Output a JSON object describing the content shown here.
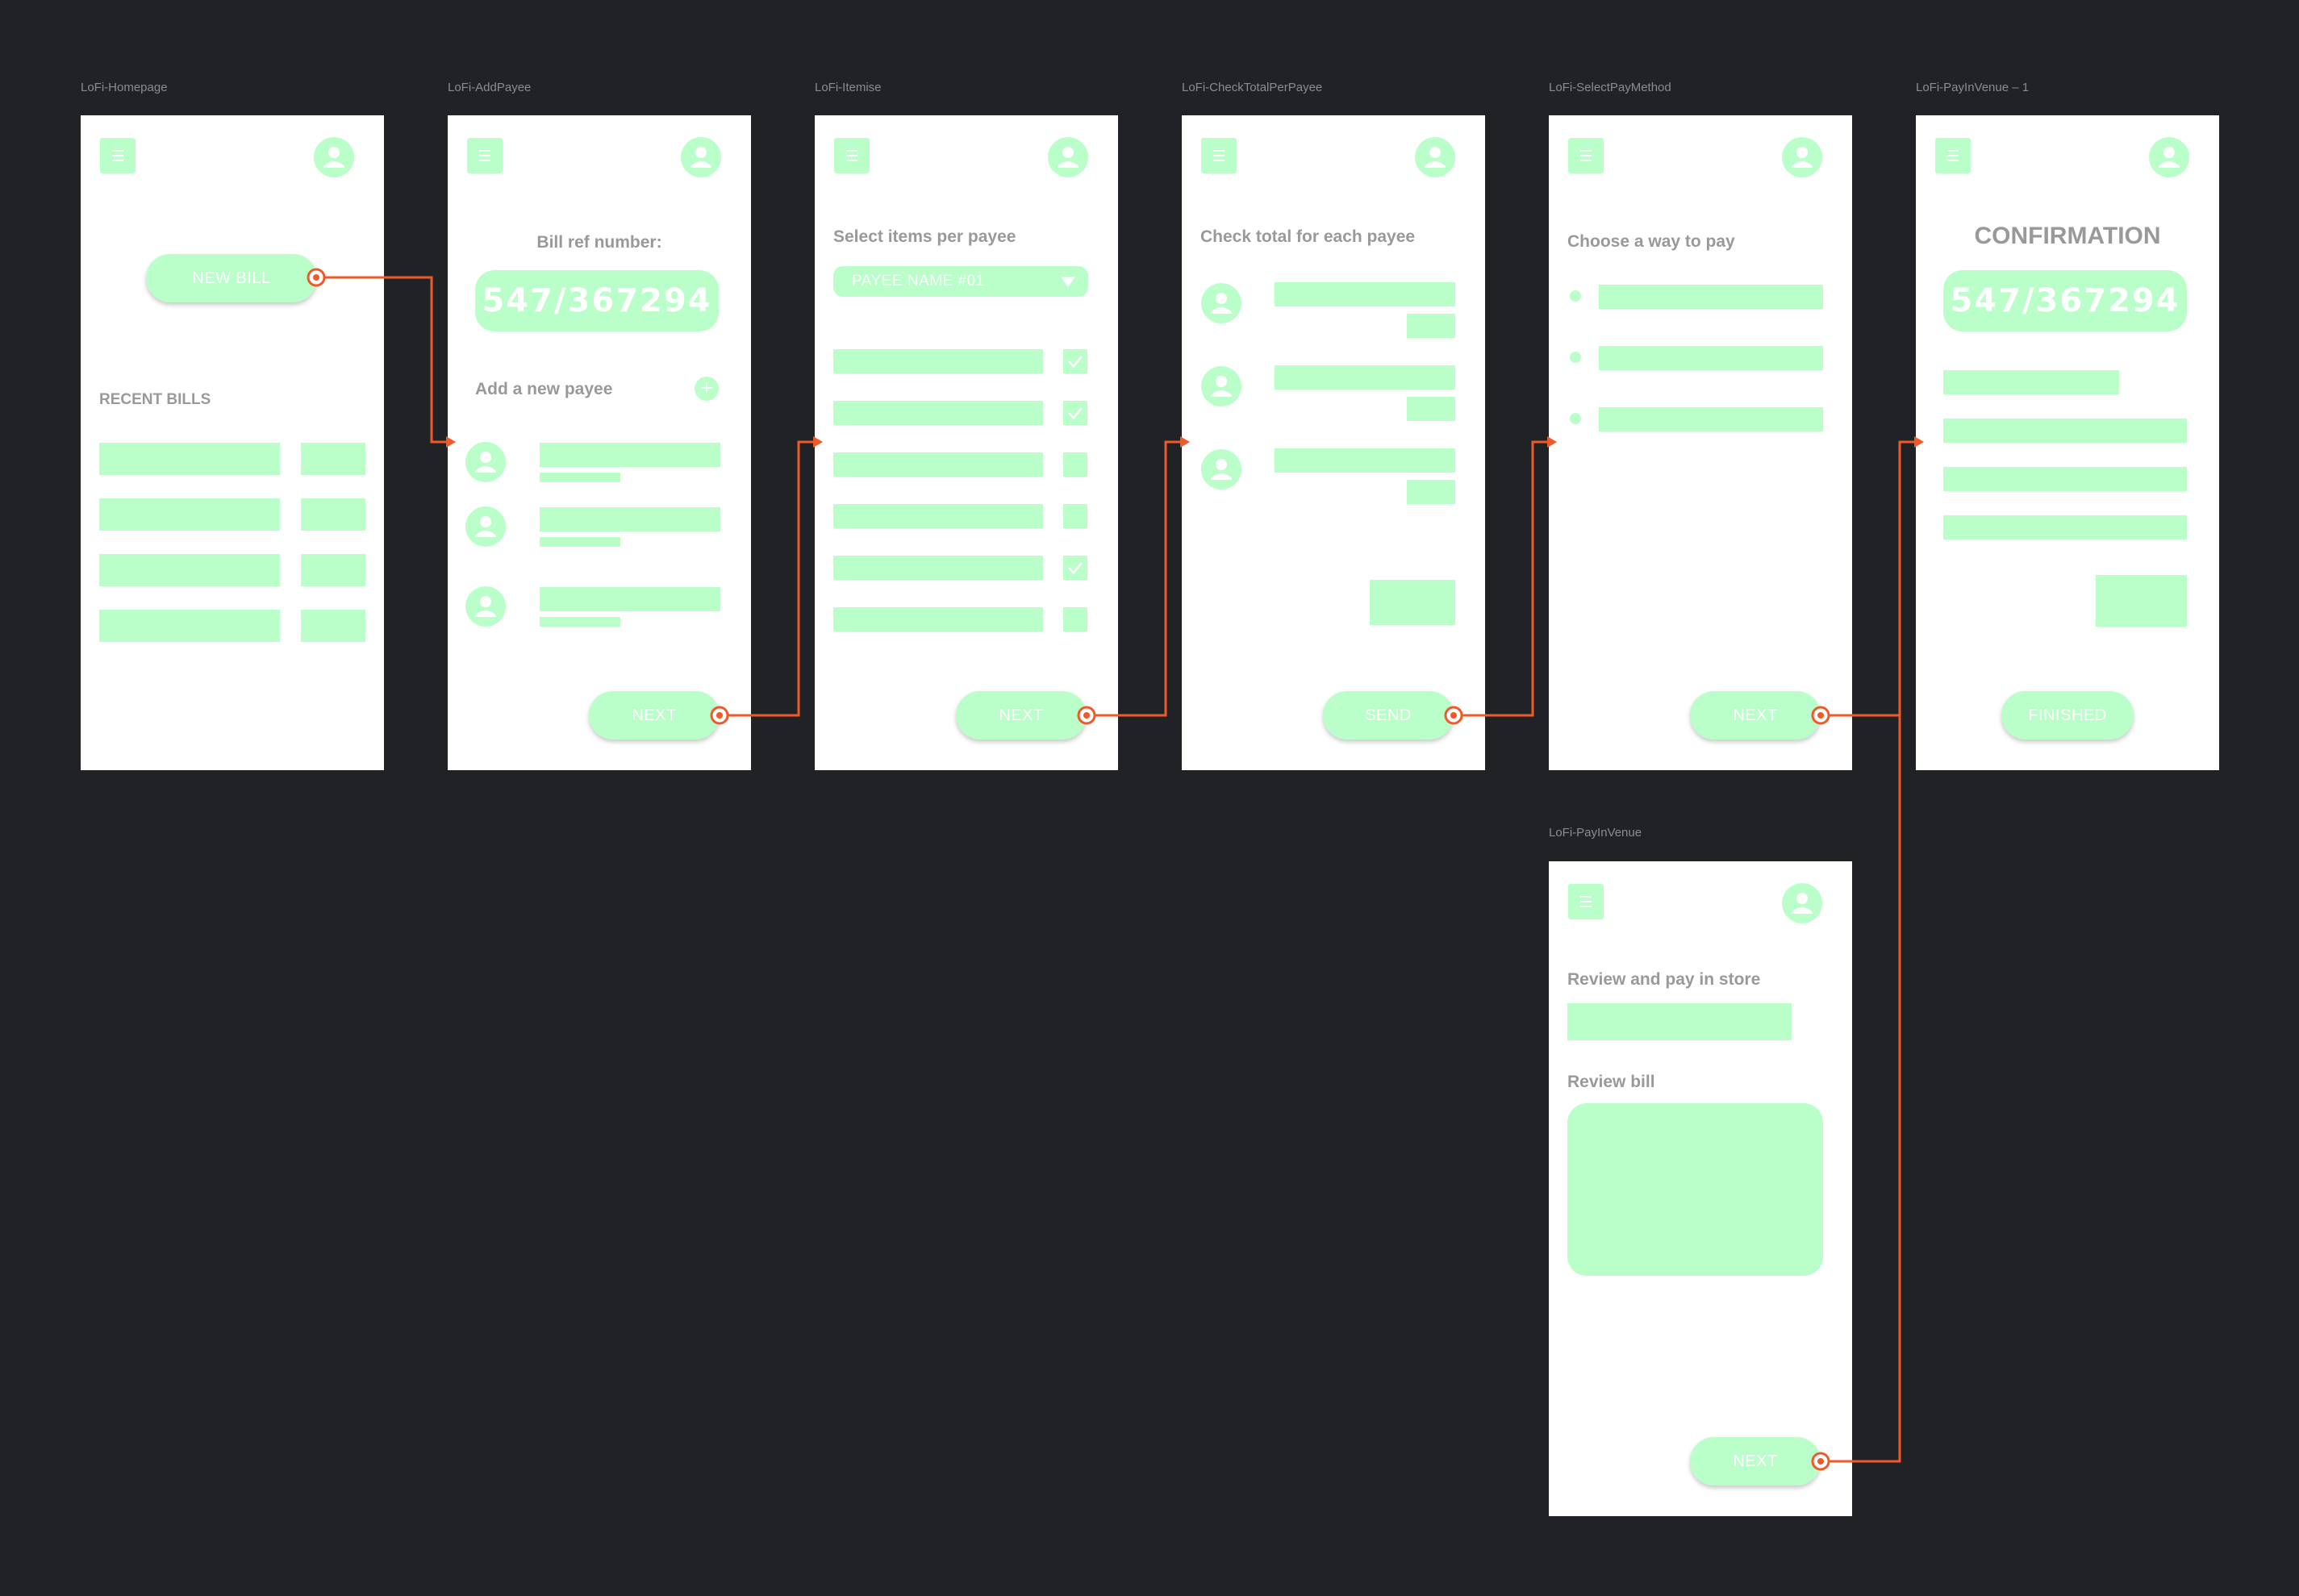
{
  "labels": {
    "homepage": "LoFi-Homepage",
    "add_payee": "LoFi-AddPayee",
    "itemise": "LoFi-Itemise",
    "check_total": "LoFi-CheckTotalPerPayee",
    "select_pay": "LoFi-SelectPayMethod",
    "pay_in_venue_1": "LoFi-PayInVenue – 1",
    "pay_in_venue": "LoFi-PayInVenue"
  },
  "homepage": {
    "new_bill": "NEW BILL",
    "recent_bills": "RECENT BILLS"
  },
  "add_payee": {
    "bill_ref_label": "Bill ref number:",
    "bill_ref": "547/367294",
    "add_payee": "Add a new payee",
    "plus": "+",
    "next": "NEXT"
  },
  "itemise": {
    "title": "Select items per payee",
    "payee_select": "PAYEE NAME #01",
    "checked": [
      true,
      true,
      false,
      false,
      true,
      false
    ],
    "next": "NEXT"
  },
  "check_total": {
    "title": "Check total for each payee",
    "send": "SEND"
  },
  "select_pay": {
    "title": "Choose a way to pay",
    "next": "NEXT"
  },
  "confirmation": {
    "title": "CONFIRMATION",
    "bill_ref": "547/367294",
    "finished": "FINISHED"
  },
  "pay_in_venue": {
    "review_pay": "Review and pay in store",
    "review_bill": "Review bill",
    "next": "NEXT"
  },
  "colors": {
    "canvas": "#212226",
    "artboard": "#ffffff",
    "wireframe_fill": "#baffca",
    "heading_text": "#999999",
    "flow_arrow": "#f05a28"
  }
}
